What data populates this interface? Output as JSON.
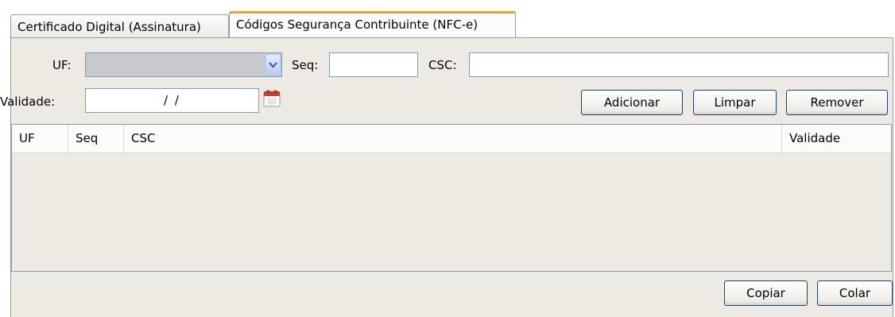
{
  "tabs": [
    {
      "label": "Certificado Digital (Assinatura)"
    },
    {
      "label": "Códigos Segurança Contribuinte (NFC-e)"
    }
  ],
  "form": {
    "uf_label": "UF:",
    "uf_value": "",
    "seq_label": "Seq:",
    "seq_value": "",
    "csc_label": "CSC:",
    "csc_value": "",
    "validade_label": "Validade:",
    "validade_value": "/ /"
  },
  "buttons": {
    "adicionar": "Adicionar",
    "limpar": "Limpar",
    "remover": "Remover",
    "copiar": "Copiar",
    "colar": "Colar"
  },
  "table": {
    "columns": [
      {
        "label": "UF"
      },
      {
        "label": "Seq"
      },
      {
        "label": "CSC"
      },
      {
        "label": "Validade"
      }
    ],
    "rows": []
  },
  "colors": {
    "panel_bg": "#eceae2",
    "active_tab_accent": "#f0a030",
    "border": "#7f9db9"
  }
}
